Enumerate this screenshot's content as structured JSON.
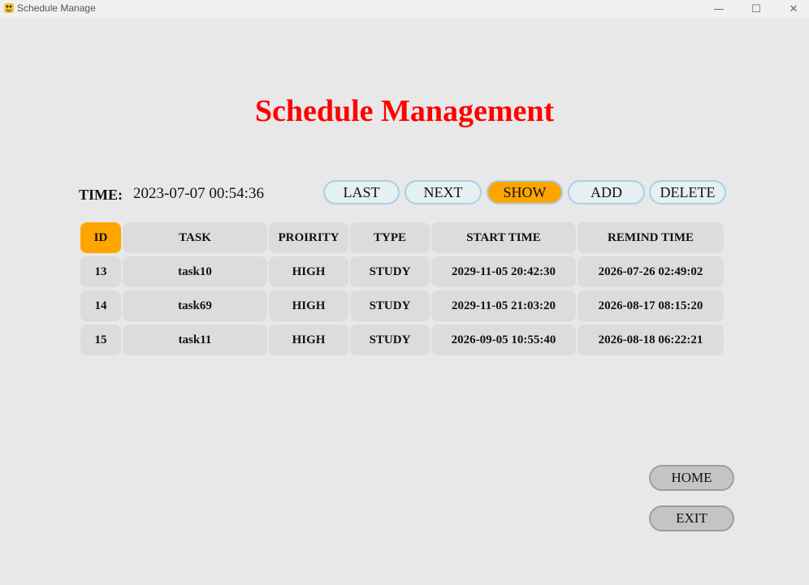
{
  "window": {
    "title": "Schedule Manage",
    "controls": [
      "—",
      "☐",
      "✕"
    ]
  },
  "page": {
    "title": "Schedule Management"
  },
  "time": {
    "label": "TIME:",
    "value": "2023-07-07 00:54:36"
  },
  "nav_buttons": [
    "LAST",
    "NEXT",
    "SHOW",
    "ADD",
    "DELETE"
  ],
  "active_button": "SHOW",
  "table": {
    "headers": [
      "ID",
      "TASK",
      "PROIRITY",
      "TYPE",
      "START TIME",
      "REMIND TIME"
    ],
    "rows": [
      [
        "13",
        "task10",
        "HIGH",
        "STUDY",
        "2029-11-05 20:42:30",
        "2026-07-26 02:49:02"
      ],
      [
        "14",
        "task69",
        "HIGH",
        "STUDY",
        "2029-11-05 21:03:20",
        "2026-08-17 08:15:20"
      ],
      [
        "15",
        "task11",
        "HIGH",
        "STUDY",
        "2026-09-05 10:55:40",
        "2026-08-18 06:22:21"
      ]
    ]
  },
  "footer_buttons": {
    "home": "HOME",
    "exit": "EXIT"
  },
  "colors": {
    "title": "#ff0000",
    "active": "#ffa500",
    "button_light": "#e4f0f2",
    "button_border": "#a9cfe7",
    "cell": "#dcdcdc"
  }
}
